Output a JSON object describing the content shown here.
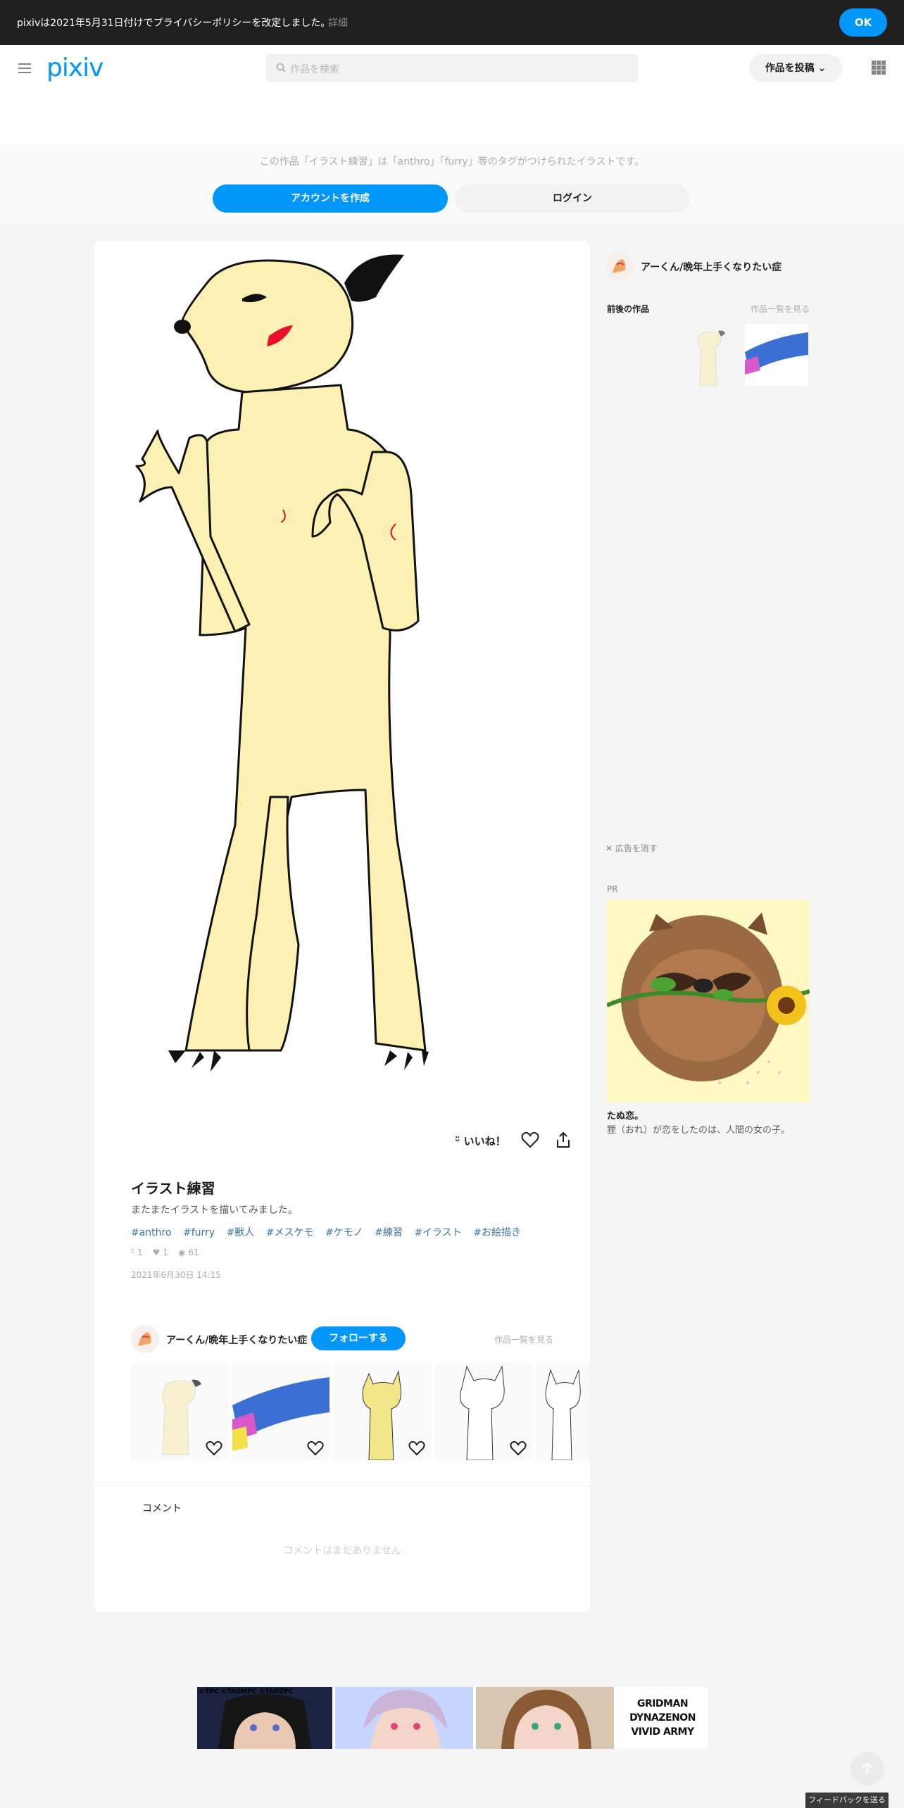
{
  "notice": {
    "text": "pixivは2021年5月31日付けでプライバシーポリシーを改定しました。",
    "more": "詳細",
    "ok": "OK"
  },
  "header": {
    "logo": "pixiv",
    "search_placeholder": "作品を検索",
    "post_button": "作品を投稿",
    "menu_icon": "hamburger-icon",
    "apps_icon": "grid-icon"
  },
  "tagbar": {
    "message": "この作品「イラスト練習」は「anthro」「furry」等のタグがつけられたイラストです。",
    "create_account": "アカウントを作成",
    "login": "ログイン"
  },
  "artwork": {
    "like_label": "いいね！",
    "title": "イラスト練習",
    "caption": "またまたイラストを描いてみました。",
    "tags": [
      "#anthro",
      "#furry",
      "#獣人",
      "#メスケモ",
      "#ケモノ",
      "#練習",
      "#イラスト",
      "#お絵描き"
    ],
    "stats": {
      "likes": "1",
      "bookmarks": "1",
      "views": "61"
    },
    "date": "2021年6月30日 14:15"
  },
  "author": {
    "name": "アーくん/晩年上手くなりたい症",
    "follow": "フォローする",
    "see_all": "作品一覧を見る"
  },
  "comments": {
    "heading": "コメント",
    "empty": "コメントはまだありません"
  },
  "side": {
    "author_name": "アーくん/晩年上手くなりたい症",
    "prev_next": "前後の作品",
    "see_all": "作品一覧を見る",
    "remove_ad": "広告を消す",
    "pr": "PR",
    "ad_title": "たぬ恋。",
    "ad_desc": "狸（おれ）が恋をしたのは、人間の女の子。"
  },
  "banner": {
    "credit": "©TPC ©TAGMPC ©TADZPC",
    "logo1": "GRIDMAN",
    "logo2": "DYNAZENON",
    "logo3": "VIVID ARMY"
  },
  "feedback": "フィードバックを送る",
  "colors": {
    "accent": "#0096fa",
    "tag": "#3d7699",
    "notice_bg": "#1f1f1f"
  }
}
